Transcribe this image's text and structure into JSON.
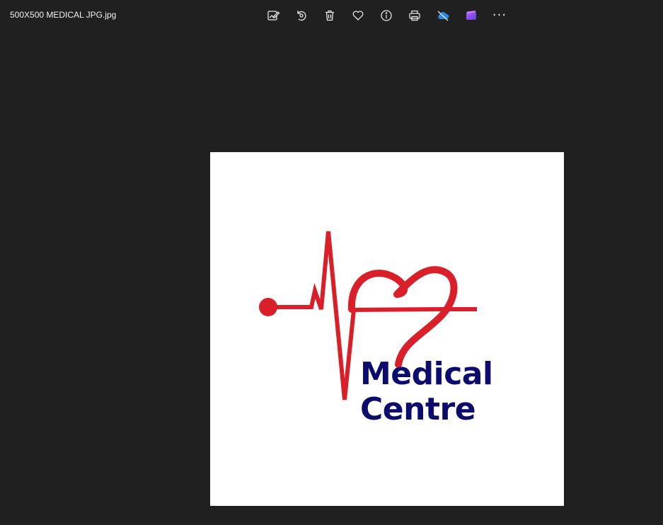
{
  "window": {
    "title": "500X500 MEDICAL JPG.jpg"
  },
  "toolbar": {
    "items": [
      {
        "icon": "edit-image-icon"
      },
      {
        "icon": "rotate-icon"
      },
      {
        "icon": "delete-icon"
      },
      {
        "icon": "favorite-heart-icon"
      },
      {
        "icon": "info-icon"
      },
      {
        "icon": "print-icon"
      },
      {
        "icon": "cloud-sync-off-icon"
      },
      {
        "icon": "clipchamp-icon"
      }
    ],
    "more_label": "···"
  },
  "image": {
    "logo_text_line1": "Medical",
    "logo_text_line2": "Centre",
    "colors": {
      "heartbeat": "#d9202a",
      "text": "#0c0c6e",
      "background": "#ffffff"
    }
  }
}
